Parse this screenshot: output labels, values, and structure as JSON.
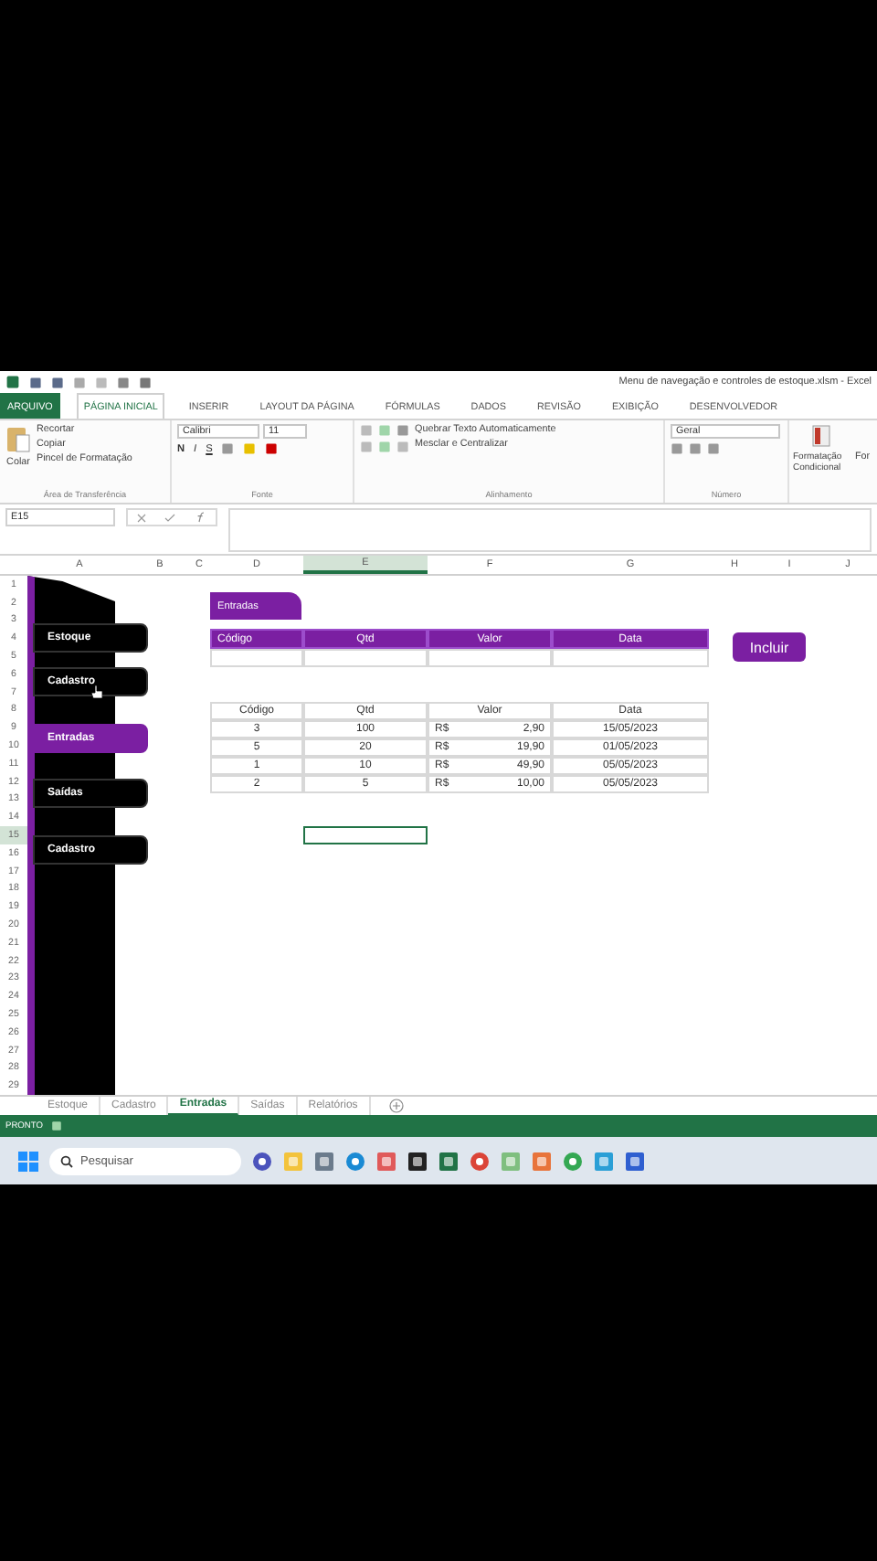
{
  "title": "Menu de navegação e controles de estoque.xlsm - Excel",
  "ribbon_tabs": [
    {
      "label": "ARQUIVO",
      "kind": "file",
      "selected": false
    },
    {
      "label": "PÁGINA INICIAL",
      "kind": "tab",
      "selected": true
    },
    {
      "label": "INSERIR",
      "kind": "tab",
      "selected": false
    },
    {
      "label": "LAYOUT DA PÁGINA",
      "kind": "tab",
      "selected": false
    },
    {
      "label": "FÓRMULAS",
      "kind": "tab",
      "selected": false
    },
    {
      "label": "DADOS",
      "kind": "tab",
      "selected": false
    },
    {
      "label": "REVISÃO",
      "kind": "tab",
      "selected": false
    },
    {
      "label": "EXIBIÇÃO",
      "kind": "tab",
      "selected": false
    },
    {
      "label": "DESENVOLVEDOR",
      "kind": "tab",
      "selected": false
    }
  ],
  "clipboard": {
    "paste": "Colar",
    "cut": "Recortar",
    "copy": "Copiar",
    "format_painter": "Pincel de Formatação",
    "group": "Área de Transferência"
  },
  "font": {
    "name": "Calibri",
    "size": "11",
    "bold": "N",
    "italic": "I",
    "underline": "S",
    "group": "Fonte"
  },
  "alignment": {
    "wrap": "Quebrar Texto Automaticamente",
    "merge": "Mesclar e Centralizar",
    "group": "Alinhamento"
  },
  "number": {
    "format": "Geral",
    "group": "Número"
  },
  "styles": {
    "conditional": "Formatação Condicional",
    "next": "For"
  },
  "name_box": "E15",
  "columns": [
    {
      "label": "A",
      "selected": false
    },
    {
      "label": "B",
      "selected": false
    },
    {
      "label": "C",
      "selected": false
    },
    {
      "label": "D",
      "selected": false
    },
    {
      "label": "E",
      "selected": true
    },
    {
      "label": "F",
      "selected": false
    },
    {
      "label": "G",
      "selected": false
    },
    {
      "label": "H",
      "selected": false
    },
    {
      "label": "I",
      "selected": false
    },
    {
      "label": "J",
      "selected": false
    }
  ],
  "rows": [
    {
      "label": "1",
      "selected": false
    },
    {
      "label": "2",
      "selected": false
    },
    {
      "label": "3",
      "selected": false
    },
    {
      "label": "4",
      "selected": false
    },
    {
      "label": "5",
      "selected": false
    },
    {
      "label": "6",
      "selected": false
    },
    {
      "label": "7",
      "selected": false
    },
    {
      "label": "8",
      "selected": false
    },
    {
      "label": "9",
      "selected": false
    },
    {
      "label": "10",
      "selected": false
    },
    {
      "label": "11",
      "selected": false
    },
    {
      "label": "12",
      "selected": false
    },
    {
      "label": "13",
      "selected": false
    },
    {
      "label": "14",
      "selected": false
    },
    {
      "label": "15",
      "selected": true
    },
    {
      "label": "16",
      "selected": false
    },
    {
      "label": "17",
      "selected": false
    },
    {
      "label": "18",
      "selected": false
    },
    {
      "label": "19",
      "selected": false
    },
    {
      "label": "20",
      "selected": false
    },
    {
      "label": "21",
      "selected": false
    },
    {
      "label": "22",
      "selected": false
    },
    {
      "label": "23",
      "selected": false
    },
    {
      "label": "24",
      "selected": false
    },
    {
      "label": "25",
      "selected": false
    },
    {
      "label": "26",
      "selected": false
    },
    {
      "label": "27",
      "selected": false
    },
    {
      "label": "28",
      "selected": false
    },
    {
      "label": "29",
      "selected": false
    }
  ],
  "nav_buttons": [
    {
      "label": "Estoque",
      "selected": false
    },
    {
      "label": "Cadastro",
      "selected": false
    },
    {
      "label": "Entradas",
      "selected": true
    },
    {
      "label": "Saídas",
      "selected": false
    },
    {
      "label": "Cadastro",
      "selected": false
    }
  ],
  "form": {
    "title": "Entradas",
    "columns": [
      "Código",
      "Qtd",
      "Valor",
      "Data"
    ],
    "button": "Incluir"
  },
  "records": {
    "columns": [
      "Código",
      "Qtd",
      "Valor",
      "Data"
    ],
    "rows": [
      {
        "code": "3",
        "qty": "100",
        "currency": "R$",
        "value": "2,90",
        "date": "15/05/2023"
      },
      {
        "code": "5",
        "qty": "20",
        "currency": "R$",
        "value": "19,90",
        "date": "01/05/2023"
      },
      {
        "code": "1",
        "qty": "10",
        "currency": "R$",
        "value": "49,90",
        "date": "05/05/2023"
      },
      {
        "code": "2",
        "qty": "5",
        "currency": "R$",
        "value": "10,00",
        "date": "05/05/2023"
      }
    ]
  },
  "sheet_tabs": [
    {
      "label": "Estoque",
      "selected": false
    },
    {
      "label": "Cadastro",
      "selected": false
    },
    {
      "label": "Entradas",
      "selected": true
    },
    {
      "label": "Saídas",
      "selected": false
    },
    {
      "label": "Relatórios",
      "selected": false
    }
  ],
  "status": "PRONTO",
  "search_placeholder": "Pesquisar"
}
